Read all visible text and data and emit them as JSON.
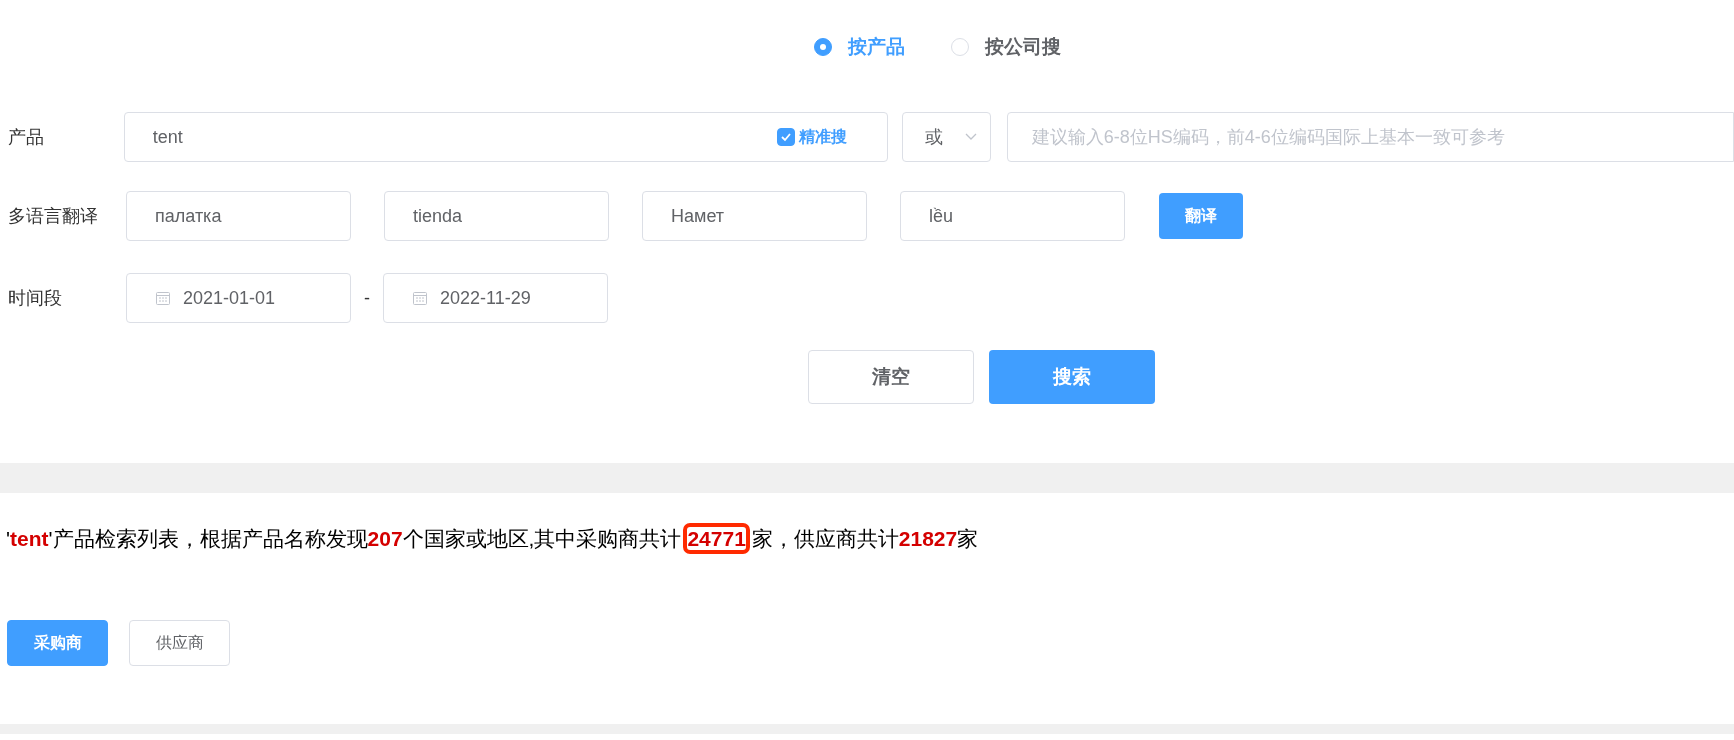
{
  "search_mode": [
    {
      "label": "按产品",
      "selected": true
    },
    {
      "label": "按公司搜",
      "selected": false
    }
  ],
  "product": {
    "label": "产品",
    "value": "tent",
    "exact": {
      "label": "精准搜",
      "checked": true
    },
    "operator": "或",
    "hs_placeholder": "建议输入6-8位HS编码，前4-6位编码国际上基本一致可参考"
  },
  "translation": {
    "label": "多语言翻译",
    "values": [
      "палатка",
      "tienda",
      "Намет",
      "lều"
    ],
    "button": "翻译"
  },
  "period": {
    "label": "时间段",
    "from": "2021-01-01",
    "separator": "-",
    "to": "2022-11-29"
  },
  "actions": [
    {
      "label": "清空",
      "kind": "secondary"
    },
    {
      "label": "搜索",
      "kind": "primary"
    }
  ],
  "summary": [
    {
      "text": "'",
      "emphasis": false,
      "highlighted": false
    },
    {
      "text": "tent",
      "emphasis": true,
      "highlighted": false
    },
    {
      "text": "'产品检索列表，根据产品名称发现",
      "emphasis": false,
      "highlighted": false
    },
    {
      "text": "207",
      "emphasis": true,
      "highlighted": false
    },
    {
      "text": "个国家或地区,其中采购商共计",
      "emphasis": false,
      "highlighted": false
    },
    {
      "text": "24771",
      "emphasis": true,
      "highlighted": true
    },
    {
      "text": "家，供应商共计",
      "emphasis": false,
      "highlighted": false
    },
    {
      "text": "21827",
      "emphasis": true,
      "highlighted": false
    },
    {
      "text": "家",
      "emphasis": false,
      "highlighted": false
    }
  ],
  "result_tabs": [
    {
      "label": "采购商",
      "selected": true
    },
    {
      "label": "供应商",
      "selected": false
    }
  ]
}
